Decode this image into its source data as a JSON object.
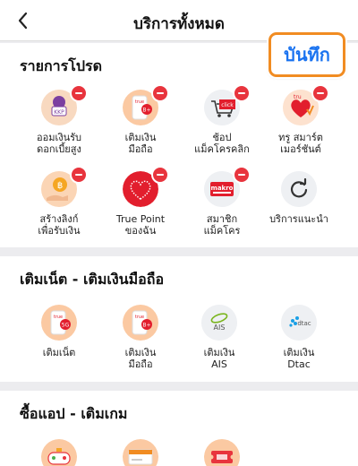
{
  "header": {
    "title": "บริการทั้งหมด"
  },
  "save_button": {
    "label": "บันทึก"
  },
  "sections": [
    {
      "title": "รายการโปรด",
      "items": [
        {
          "label": "ออมเงินรับ\nดอกเบี้ยสูง",
          "icon": "kkp-savings-icon"
        },
        {
          "label": "เติมเงิน\nมือถือ",
          "icon": "true-topup-icon"
        },
        {
          "label": "ช้อป\nแม็คโครคลิก",
          "icon": "makro-click-icon"
        },
        {
          "label": "ทรู สมาร์ต\nเมอร์ชันต์",
          "icon": "true-smart-merchant-icon"
        },
        {
          "label": "สร้างลิงก์\nเพื่อรับเงิน",
          "icon": "payment-link-icon"
        },
        {
          "label": "True Point\nของฉัน",
          "icon": "true-point-icon"
        },
        {
          "label": "สมาชิก\nแม็คโคร",
          "icon": "makro-member-icon"
        },
        {
          "label": "บริการแนะนำ",
          "icon": "refresh-icon"
        }
      ]
    },
    {
      "title": "เติมเน็ต - เติมเงินมือถือ",
      "items": [
        {
          "label": "เติมเน็ต",
          "icon": "true-5g-icon"
        },
        {
          "label": "เติมเงิน\nมือถือ",
          "icon": "true-topup-icon"
        },
        {
          "label": "เติมเงิน\nAIS",
          "icon": "ais-icon"
        },
        {
          "label": "เติมเงิน\nDtac",
          "icon": "dtac-icon"
        }
      ]
    },
    {
      "title": "ซื้อแอป - เติมเกม",
      "items": [
        {
          "label": "",
          "icon": "game-controller-icon"
        },
        {
          "label": "",
          "icon": "truemoney-card-icon"
        },
        {
          "label": "",
          "icon": "ticket-icon"
        }
      ]
    }
  ],
  "colors": {
    "accent": "#f18c22",
    "save_text": "#1a73f0",
    "remove_badge": "#e8343d",
    "true_red": "#e21e2d"
  }
}
